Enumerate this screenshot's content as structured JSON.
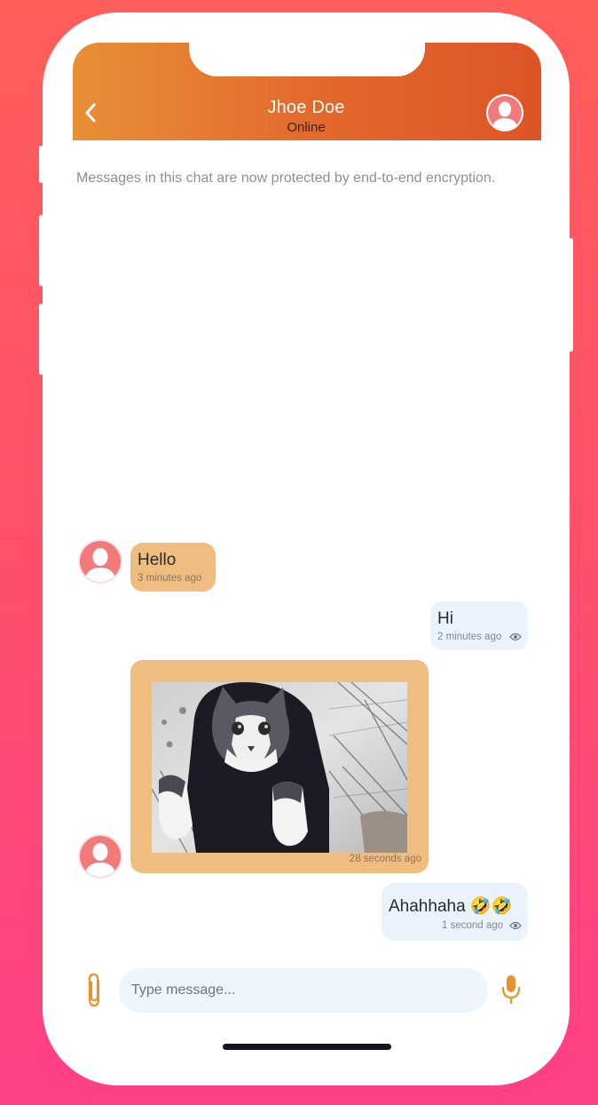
{
  "header": {
    "contact_name": "Jhoe Doe",
    "contact_status": "Online",
    "accent_start": "#e88f35",
    "accent_end": "#de5528"
  },
  "encryption_notice": "Messages in this chat are now protected by end-to-end encryption.",
  "messages": [
    {
      "direction": "incoming",
      "type": "text",
      "text": "Hello",
      "time": "3 minutes ago"
    },
    {
      "direction": "outgoing",
      "type": "text",
      "text": "Hi",
      "time": "2 minutes ago",
      "seen_icon": "eye-icon"
    },
    {
      "direction": "incoming",
      "type": "image",
      "image": "cat-photo",
      "time": "28 seconds ago"
    },
    {
      "direction": "outgoing",
      "type": "text",
      "text": "Ahahhaha 🤣🤣",
      "time": "1 second ago",
      "seen_icon": "eye-icon"
    }
  ],
  "composer": {
    "placeholder": "Type message...",
    "attach_icon": "paperclip-icon",
    "mic_icon": "microphone-icon"
  },
  "colors": {
    "incoming_bubble": "#f0bd81",
    "outgoing_bubble": "#eaf3fc",
    "avatar": "#f27a7a"
  }
}
